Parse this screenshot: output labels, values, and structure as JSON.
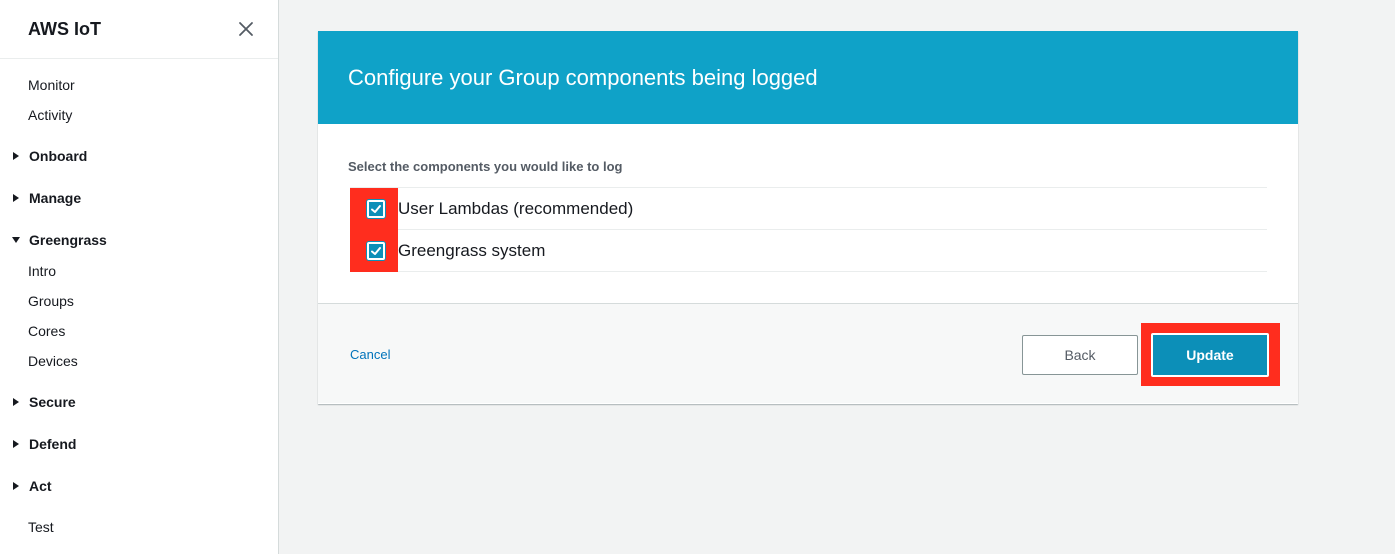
{
  "sidebar": {
    "title": "AWS IoT",
    "close_icon": "close-icon",
    "items": [
      {
        "label": "Monitor",
        "type": "sub"
      },
      {
        "label": "Activity",
        "type": "sub"
      },
      {
        "label": "Onboard",
        "type": "section",
        "expanded": false
      },
      {
        "label": "Manage",
        "type": "section",
        "expanded": false
      },
      {
        "label": "Greengrass",
        "type": "section",
        "expanded": true
      },
      {
        "label": "Intro",
        "type": "sub"
      },
      {
        "label": "Groups",
        "type": "sub"
      },
      {
        "label": "Cores",
        "type": "sub"
      },
      {
        "label": "Devices",
        "type": "sub"
      },
      {
        "label": "Secure",
        "type": "section",
        "expanded": false
      },
      {
        "label": "Defend",
        "type": "section",
        "expanded": false
      },
      {
        "label": "Act",
        "type": "section",
        "expanded": false
      },
      {
        "label": "Test",
        "type": "sub"
      }
    ]
  },
  "card": {
    "title": "Configure your Group components being logged",
    "section_label": "Select the components you would like to log",
    "options": [
      {
        "label": "User Lambdas (recommended)",
        "checked": true
      },
      {
        "label": "Greengrass system",
        "checked": true
      }
    ]
  },
  "footer": {
    "cancel_label": "Cancel",
    "back_label": "Back",
    "update_label": "Update"
  },
  "colors": {
    "header_bg": "#0fa2c8",
    "primary_button": "#0c8fb8",
    "link": "#0073bb",
    "highlight": "#ff2d1e"
  }
}
